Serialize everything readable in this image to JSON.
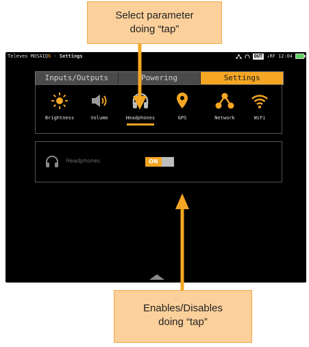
{
  "statusbar": {
    "brand": "Televes MOSAIQ",
    "brand_suffix": "6",
    "separator": " - ",
    "section": "Settings",
    "out_badge": "OUT",
    "rf_label": "↓RF",
    "time": "12:04"
  },
  "tabs": [
    {
      "label": "Inputs/Outputs",
      "active": false
    },
    {
      "label": "Powering",
      "active": false
    },
    {
      "label": "Settings",
      "active": true
    }
  ],
  "params": [
    {
      "label": "Brightness",
      "icon": "sun-icon"
    },
    {
      "label": "Volume",
      "icon": "speaker-icon"
    },
    {
      "label": "Headphones",
      "icon": "headphones-icon",
      "selected": true
    },
    {
      "label": "GPS",
      "icon": "location-pin-icon"
    },
    {
      "label": "Network",
      "icon": "network-icon"
    },
    {
      "label": "WiFi",
      "icon": "wifi-icon"
    }
  ],
  "option": {
    "label": "Headphones",
    "toggle_state": "ON"
  },
  "callouts": {
    "top": {
      "line1": "Select parameter",
      "line2": "doing “tap”"
    },
    "bottom": {
      "line1": "Enables/Disables",
      "line2": "doing “tap”"
    }
  },
  "colors": {
    "accent": "#f5a623",
    "callout_fill": "#fcd09b",
    "screen_bg": "#000000"
  }
}
